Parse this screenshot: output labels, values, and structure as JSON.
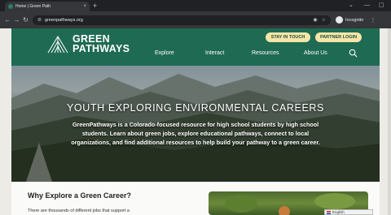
{
  "browser": {
    "tab_title": "Home | Green Path",
    "tab_close": "×",
    "new_tab": "+",
    "url": "greenpathways.org",
    "incognito_label": "Incognito",
    "window_controls": [
      "⌄",
      "—",
      "▢"
    ]
  },
  "header": {
    "logo_line1": "GREEN",
    "logo_line2": "PATHWAYS",
    "pill_buttons": [
      "STAY IN TOUCH",
      "PARTNER LOGIN"
    ],
    "nav": [
      "Explore",
      "Interact",
      "Resources",
      "About Us"
    ],
    "search_icon": "search-icon"
  },
  "hero": {
    "title": "YOUTH EXPLORING ENVIRONMENTAL CAREERS",
    "body": "GreenPathways is a Colorado-focused resource for high school students by high school students. Learn about green jobs, explore educational pathways, connect to local organizations, and find additional resources to help build your pathway to a green career."
  },
  "content": {
    "heading": "Why Explore a Green Career?",
    "text": "There are thousands of different jobs that support a"
  },
  "language_widget": {
    "label": "English"
  },
  "colors": {
    "header_green": "#1f6a52",
    "pill_yellow": "#f5e6a8",
    "chrome_dark": "#202124"
  }
}
